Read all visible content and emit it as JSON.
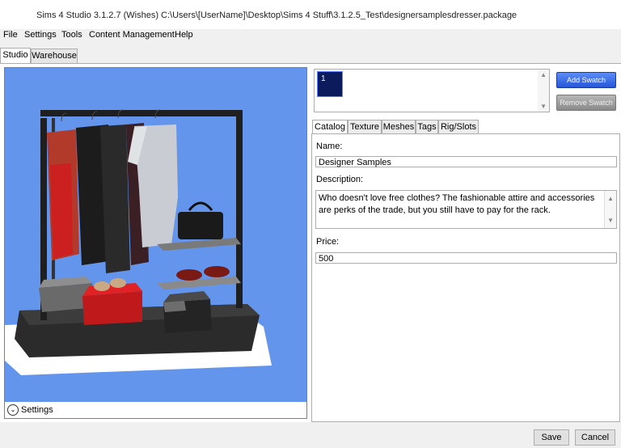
{
  "window": {
    "title": "Sims 4 Studio 3.1.2.7 (Wishes)  C:\\Users\\[UserName]\\Desktop\\Sims 4 Stuff\\3.1.2.5_Test\\designersamplesdresser.package"
  },
  "menu": [
    "File",
    "Settings",
    "Tools",
    "Content Management",
    "Help"
  ],
  "tabs": [
    "Studio",
    "Warehouse"
  ],
  "viewport": {
    "settings_label": "Settings",
    "background_color": "#6495ed"
  },
  "swatches": {
    "items": [
      "1"
    ],
    "add_label": "Add Swatch",
    "remove_label": "Remove Swatch"
  },
  "right_tabs": [
    "Catalog",
    "Texture",
    "Meshes",
    "Tags",
    "Rig/Slots"
  ],
  "catalog": {
    "name_label": "Name:",
    "name_value": "Designer Samples",
    "description_label": "Description:",
    "description_value": "Who doesn't love free clothes? The fashionable attire and accessories are perks of the trade, but you still have to pay for the rack.",
    "price_label": "Price:",
    "price_value": "500"
  },
  "footer": {
    "save_label": "Save",
    "cancel_label": "Cancel"
  }
}
